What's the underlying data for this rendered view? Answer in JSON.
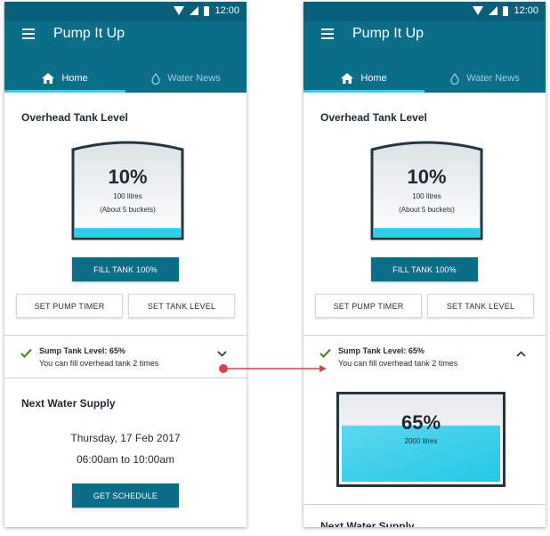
{
  "status_bar": {
    "time": "12:00"
  },
  "app": {
    "title": "Pump It Up"
  },
  "tabs": [
    {
      "label": "Home",
      "icon": "home-icon",
      "active": true
    },
    {
      "label": "Water News",
      "icon": "water-drop-icon",
      "active": false
    }
  ],
  "overhead": {
    "title": "Overhead Tank Level",
    "percent": "10%",
    "level": 0.1,
    "litres": "100 litres",
    "buckets": "(About 5 buckets)",
    "fill_button": "FILL TANK 100%",
    "pump_timer_button": "SET PUMP TIMER",
    "tank_level_button": "SET TANK LEVEL"
  },
  "sump": {
    "title": "Sump Tank Level: 65%",
    "subtitle": "You can fill overhead tank 2 times",
    "percent": "65%",
    "level": 0.65,
    "litres": "2000 litres"
  },
  "supply": {
    "title": "Next Water Supply",
    "date": "Thursday, 17 Feb 2017",
    "time": "06:00am to 10:00am",
    "schedule_button": "GET SCHEDULE"
  },
  "colors": {
    "app_bar": "#0a6e89",
    "tab_indicator": "#3ac7e8",
    "water": "#2ad0ee",
    "check": "#4a8a1f",
    "arrow": "#d9434b"
  }
}
